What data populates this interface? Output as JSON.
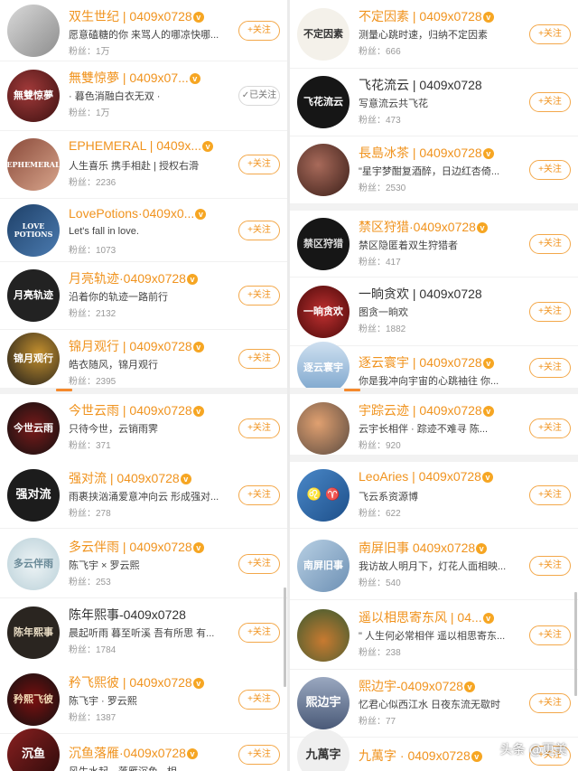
{
  "follow_label": "+关注",
  "followed_label": "✓已关注",
  "fans_label": "粉丝：",
  "left_list": [
    {
      "name": "双生世纪 | 0409x0728",
      "verified": true,
      "highlight": true,
      "desc": "愿意磕糖的你 来骂人的哪凉快哪...",
      "fans": "1万",
      "followed": false,
      "avatar": {
        "text": "",
        "bg": "linear-gradient(135deg,#d9d9d9,#8d8d8d)",
        "color": "#fff"
      }
    },
    {
      "name": "無雙惊夢 | 0409x07...",
      "verified": true,
      "highlight": true,
      "desc": "· 暮色消融白衣无双 ·",
      "fans": "1万",
      "followed": true,
      "avatar": {
        "text": "無雙惊夢",
        "bg": "radial-gradient(circle at 40% 40%,#a23a3a,#3b1010)",
        "color": "#fff"
      }
    },
    {
      "name": "EPHEMERAL | 0409x...",
      "verified": true,
      "highlight": true,
      "desc": "人生喜乐 携手相赴 | 授权右滑",
      "fans": "2236",
      "followed": false,
      "avatar": {
        "text": "EPHEMERAL",
        "bg": "linear-gradient(135deg,#8a4a3a,#d8a58c)",
        "color": "#fff"
      }
    },
    {
      "name": "LovePotions·0409x0...",
      "verified": true,
      "highlight": true,
      "desc": "Let's fall in love.",
      "fans": "1073",
      "followed": false,
      "avatar": {
        "text": "LOVE POTIONS",
        "bg": "linear-gradient(135deg,#1e4068,#4b7bb0)",
        "color": "#fff"
      }
    },
    {
      "name": "月亮轨迹·0409x0728",
      "verified": true,
      "highlight": true,
      "desc": "沿着你的轨迹一路前行",
      "fans": "2132",
      "followed": false,
      "avatar": {
        "text": "月亮轨迹",
        "bg": "#222222",
        "color": "#fff"
      }
    },
    {
      "name": "锦月观行 | 0409x0728",
      "verified": true,
      "highlight": true,
      "desc": "皓衣随风，锦月观行",
      "fans": "2395",
      "followed": false,
      "avatar": {
        "text": "锦月观行",
        "bg": "radial-gradient(circle at 60% 40%,#c4902e,#1a1a1a)",
        "color": "#fff"
      }
    },
    {
      "name": "今世云雨 | 0409x0728",
      "verified": true,
      "highlight": true,
      "desc": "只待今世，云销雨霁",
      "fans": "371",
      "followed": false,
      "avatar": {
        "text": "今世云雨",
        "bg": "radial-gradient(circle,#7a1a1a,#111)",
        "color": "#fff"
      }
    },
    {
      "name": "强对流 | 0409x0728",
      "verified": true,
      "highlight": true,
      "desc": "雨裹挟汹涌爱意冲向云 形成强对...",
      "fans": "278",
      "followed": false,
      "avatar": {
        "text": "强对流",
        "bg": "#1c1c1c",
        "color": "#fff"
      }
    },
    {
      "name": "多云伴雨 | 0409x0728",
      "verified": true,
      "highlight": true,
      "desc": "陈飞宇 × 罗云熙",
      "fans": "253",
      "followed": false,
      "avatar": {
        "text": "多云伴雨",
        "bg": "radial-gradient(circle,#eef4f6,#b9d0d8)",
        "color": "#6a8a98"
      }
    },
    {
      "name": "陈年熙事-0409x0728",
      "verified": false,
      "highlight": false,
      "desc": "晨起听雨 暮至听溪 吾有所思 有...",
      "fans": "1784",
      "followed": false,
      "avatar": {
        "text": "陈年熙事",
        "bg": "#2a2520",
        "color": "#e8dcc4"
      }
    },
    {
      "name": "矜飞熙彼 | 0409x0728",
      "verified": true,
      "highlight": true,
      "desc": "陈飞宇 · 罗云熙",
      "fans": "1387",
      "followed": false,
      "avatar": {
        "text": "矜熙飞彼",
        "bg": "radial-gradient(circle,#7a1010,#111)",
        "color": "#f2d9b4"
      }
    },
    {
      "name": "沉鱼落雁·0409x0728",
      "verified": true,
      "highlight": true,
      "desc": "风生水起，落雁沉鱼 · 相...",
      "fans": "",
      "followed": false,
      "avatar": {
        "text": "沉鱼",
        "bg": "linear-gradient(135deg,#8a2020,#2a0a0a)",
        "color": "#fff"
      }
    }
  ],
  "right_list": [
    {
      "name": "不定因素 | 0409x0728",
      "verified": true,
      "highlight": true,
      "desc": "测量心跳时速，归纳不定因素",
      "fans": "666",
      "followed": false,
      "avatar": {
        "text": "不定因素",
        "bg": "#f4f1ea",
        "color": "#333"
      }
    },
    {
      "name": "飞花流云 | 0409x0728",
      "verified": false,
      "highlight": false,
      "desc": "写意流云共飞花",
      "fans": "473",
      "followed": false,
      "avatar": {
        "text": "飞花流云",
        "bg": "#161616",
        "color": "#fff"
      }
    },
    {
      "name": "長島冰茶 | 0409x0728",
      "verified": true,
      "highlight": true,
      "desc": "\"星宇梦酣复酒醉，日边红杏倚...",
      "fans": "2530",
      "followed": false,
      "avatar": {
        "text": "",
        "bg": "radial-gradient(circle at 40% 40%,#a86a5a,#3a1e18)",
        "color": "#fff"
      }
    },
    {
      "name": "禁区狩猎·0409x0728",
      "verified": true,
      "highlight": true,
      "desc": "禁区隐匿着双生狩猎者",
      "fans": "417",
      "followed": false,
      "avatar": {
        "text": "禁区狩猎",
        "bg": "#161616",
        "color": "#ddd"
      }
    },
    {
      "name": "一晌贪欢 | 0409x0728",
      "verified": false,
      "highlight": false,
      "desc": "图贪一晌欢",
      "fans": "1882",
      "followed": false,
      "avatar": {
        "text": "一晌贪欢",
        "bg": "radial-gradient(circle,#c03030,#4a0a0a)",
        "color": "#fff"
      }
    },
    {
      "name": "逐云寰宇 | 0409x0728",
      "verified": true,
      "highlight": true,
      "desc": "你是我冲向宇宙的心跳袖往 你...",
      "fans": "",
      "followed": false,
      "avatar": {
        "text": "逐云寰宇",
        "bg": "linear-gradient(180deg,#cfe0f0,#7aa4cc)",
        "color": "#fff"
      }
    },
    {
      "name": "宇踪云迹 | 0409x0728",
      "verified": true,
      "highlight": true,
      "desc": "云宇长相伴 · 踪迹不难寻       陈...",
      "fans": "920",
      "followed": false,
      "avatar": {
        "text": "",
        "bg": "radial-gradient(circle at 40% 40%,#e0a070,#5a4a40)",
        "color": "#fff"
      }
    },
    {
      "name": "LeoAries | 0409x0728",
      "verified": true,
      "highlight": true,
      "desc": "飞云系资源博",
      "fans": "622",
      "followed": false,
      "avatar": {
        "text": "♌ ♈",
        "bg": "linear-gradient(135deg,#4a88c8,#1d4f8a)",
        "color": "#fff"
      }
    },
    {
      "name": "南屏旧事 0409x0728",
      "verified": true,
      "highlight": true,
      "desc": "我访故人明月下，灯花人面相映...",
      "fans": "540",
      "followed": false,
      "avatar": {
        "text": "南屏旧事",
        "bg": "linear-gradient(135deg,#b8d0e4,#6d90b4)",
        "color": "#fff"
      }
    },
    {
      "name": "遥以相思寄东风 | 04...",
      "verified": true,
      "highlight": true,
      "desc": "\" 人生何必常相伴  遥以相思寄东...",
      "fans": "238",
      "followed": false,
      "avatar": {
        "text": "",
        "bg": "radial-gradient(circle at 50% 60%,#c87a30,#3a5a30)",
        "color": "#fff"
      }
    },
    {
      "name": "熙边宇-0409x0728",
      "verified": true,
      "highlight": true,
      "desc": "忆君心似西江水 日夜东流无歇时",
      "fans": "77",
      "followed": false,
      "avatar": {
        "text": "熙边宇",
        "bg": "linear-gradient(180deg,#9aa8c0,#4a5a78)",
        "color": "#fff"
      }
    },
    {
      "name": "九萬字 · 0409x0728",
      "verified": true,
      "highlight": true,
      "desc": "",
      "fans": "",
      "followed": false,
      "avatar": {
        "text": "九萬字",
        "bg": "#efefef",
        "color": "#333"
      }
    }
  ],
  "watermark": "头条 @更美"
}
